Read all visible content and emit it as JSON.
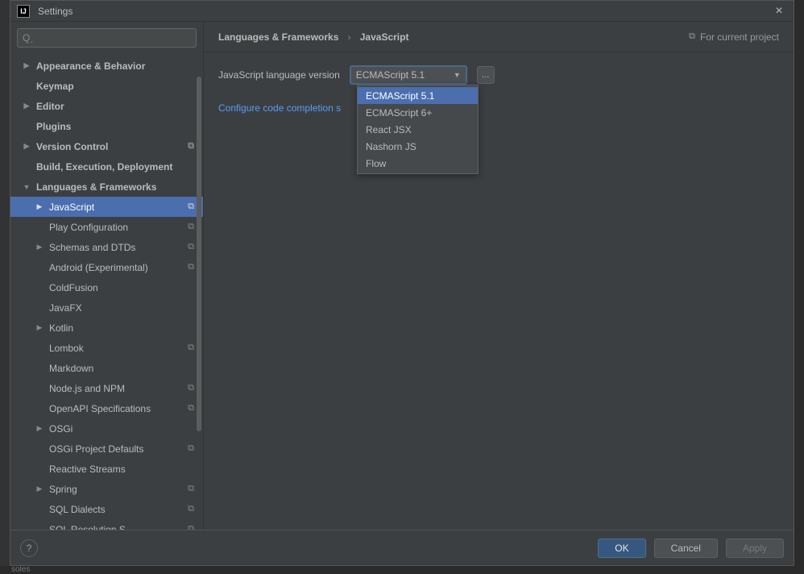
{
  "window": {
    "title": "Settings",
    "close": "×"
  },
  "search": {
    "placeholder": ""
  },
  "tree": [
    {
      "label": "Appearance & Behavior",
      "depth": 0,
      "bold": true,
      "caret": "right",
      "proj": false
    },
    {
      "label": "Keymap",
      "depth": 0,
      "bold": true,
      "caret": "none",
      "proj": false
    },
    {
      "label": "Editor",
      "depth": 0,
      "bold": true,
      "caret": "right",
      "proj": false
    },
    {
      "label": "Plugins",
      "depth": 0,
      "bold": true,
      "caret": "none",
      "proj": false
    },
    {
      "label": "Version Control",
      "depth": 0,
      "bold": true,
      "caret": "right",
      "proj": true
    },
    {
      "label": "Build, Execution, Deployment",
      "depth": 0,
      "bold": true,
      "caret": "none",
      "proj": false
    },
    {
      "label": "Languages & Frameworks",
      "depth": 0,
      "bold": true,
      "caret": "down",
      "proj": false
    },
    {
      "label": "JavaScript",
      "depth": 1,
      "bold": false,
      "caret": "right",
      "proj": true,
      "selected": true
    },
    {
      "label": "Play Configuration",
      "depth": 1,
      "bold": false,
      "caret": "none",
      "proj": true
    },
    {
      "label": "Schemas and DTDs",
      "depth": 1,
      "bold": false,
      "caret": "right",
      "proj": true
    },
    {
      "label": "Android (Experimental)",
      "depth": 1,
      "bold": false,
      "caret": "none",
      "proj": true
    },
    {
      "label": "ColdFusion",
      "depth": 1,
      "bold": false,
      "caret": "none",
      "proj": false
    },
    {
      "label": "JavaFX",
      "depth": 1,
      "bold": false,
      "caret": "none",
      "proj": false
    },
    {
      "label": "Kotlin",
      "depth": 1,
      "bold": false,
      "caret": "right",
      "proj": false
    },
    {
      "label": "Lombok",
      "depth": 1,
      "bold": false,
      "caret": "none",
      "proj": true
    },
    {
      "label": "Markdown",
      "depth": 1,
      "bold": false,
      "caret": "none",
      "proj": false
    },
    {
      "label": "Node.js and NPM",
      "depth": 1,
      "bold": false,
      "caret": "none",
      "proj": true
    },
    {
      "label": "OpenAPI Specifications",
      "depth": 1,
      "bold": false,
      "caret": "none",
      "proj": true
    },
    {
      "label": "OSGi",
      "depth": 1,
      "bold": false,
      "caret": "right",
      "proj": false
    },
    {
      "label": "OSGi Project Defaults",
      "depth": 1,
      "bold": false,
      "caret": "none",
      "proj": true
    },
    {
      "label": "Reactive Streams",
      "depth": 1,
      "bold": false,
      "caret": "none",
      "proj": false
    },
    {
      "label": "Spring",
      "depth": 1,
      "bold": false,
      "caret": "right",
      "proj": true
    },
    {
      "label": "SQL Dialects",
      "depth": 1,
      "bold": false,
      "caret": "none",
      "proj": true
    },
    {
      "label": "SQL Resolution S",
      "depth": 1,
      "bold": false,
      "caret": "none",
      "proj": true
    }
  ],
  "breadcrumb": {
    "parent": "Languages & Frameworks",
    "current": "JavaScript"
  },
  "project_badge": "For current project",
  "field": {
    "label": "JavaScript language version",
    "value": "ECMAScript 5.1"
  },
  "dropdown_options": [
    {
      "label": "ECMAScript 5.1",
      "selected": true
    },
    {
      "label": "ECMAScript 6+",
      "selected": false
    },
    {
      "label": "React JSX",
      "selected": false
    },
    {
      "label": "Nashorn JS",
      "selected": false
    },
    {
      "label": "Flow",
      "selected": false
    }
  ],
  "link_text": "Configure code completion s",
  "footer": {
    "ok": "OK",
    "cancel": "Cancel",
    "apply": "Apply",
    "help": "?"
  },
  "ellipsis": "..."
}
